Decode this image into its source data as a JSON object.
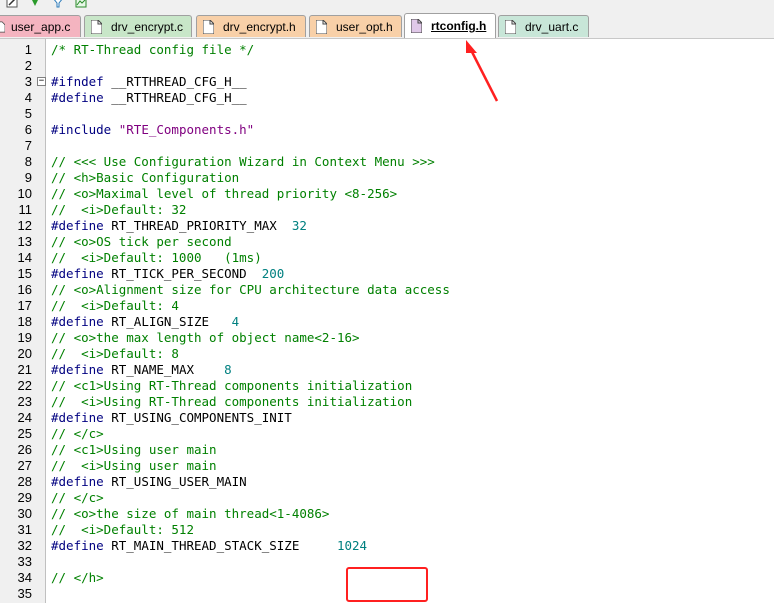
{
  "toolbar": {
    "icons": [
      "edit-icon",
      "download-icon",
      "filter-icon",
      "image-icon"
    ]
  },
  "tabs": [
    {
      "label": "user_app.c",
      "color": "#f4b4c0",
      "active": false
    },
    {
      "label": "drv_encrypt.c",
      "color": "#c8e6c8",
      "active": false
    },
    {
      "label": "drv_encrypt.h",
      "color": "#f8d0a8",
      "active": false
    },
    {
      "label": "user_opt.h",
      "color": "#f8d0a8",
      "active": false
    },
    {
      "label": "rtconfig.h",
      "color": "#e0c8e8",
      "active": true
    },
    {
      "label": "drv_uart.c",
      "color": "#c8e6d8",
      "active": false
    }
  ],
  "lines": [
    {
      "n": "1",
      "segs": [
        [
          "/* RT-Thread config file */",
          "comment"
        ]
      ]
    },
    {
      "n": "2",
      "segs": []
    },
    {
      "n": "3",
      "segs": [
        [
          "#ifndef",
          "pre"
        ],
        [
          " __RTTHREAD_CFG_H__",
          "plain"
        ]
      ],
      "fold": true
    },
    {
      "n": "4",
      "segs": [
        [
          "#define",
          "pre"
        ],
        [
          " __RTTHREAD_CFG_H__",
          "plain"
        ]
      ]
    },
    {
      "n": "5",
      "segs": []
    },
    {
      "n": "6",
      "segs": [
        [
          "#include",
          "pre"
        ],
        [
          " ",
          "plain"
        ],
        [
          "\"RTE_Components.h\"",
          "str"
        ]
      ]
    },
    {
      "n": "7",
      "segs": []
    },
    {
      "n": "8",
      "segs": [
        [
          "// <<< Use Configuration Wizard in Context Menu >>>",
          "comment"
        ]
      ]
    },
    {
      "n": "9",
      "segs": [
        [
          "// <h>Basic Configuration",
          "comment"
        ]
      ]
    },
    {
      "n": "10",
      "segs": [
        [
          "// <o>Maximal level of thread priority <8-256>",
          "comment"
        ]
      ]
    },
    {
      "n": "11",
      "segs": [
        [
          "//  <i>Default: 32",
          "comment"
        ]
      ]
    },
    {
      "n": "12",
      "segs": [
        [
          "#define",
          "pre"
        ],
        [
          " RT_THREAD_PRIORITY_MAX  ",
          "plain"
        ],
        [
          "32",
          "num"
        ]
      ]
    },
    {
      "n": "13",
      "segs": [
        [
          "// <o>OS tick per second",
          "comment"
        ]
      ]
    },
    {
      "n": "14",
      "segs": [
        [
          "//  <i>Default: 1000   (1ms)",
          "comment"
        ]
      ]
    },
    {
      "n": "15",
      "segs": [
        [
          "#define",
          "pre"
        ],
        [
          " RT_TICK_PER_SECOND  ",
          "plain"
        ],
        [
          "200",
          "num"
        ]
      ]
    },
    {
      "n": "16",
      "segs": [
        [
          "// <o>Alignment size for CPU architecture data access",
          "comment"
        ]
      ]
    },
    {
      "n": "17",
      "segs": [
        [
          "//  <i>Default: 4",
          "comment"
        ]
      ]
    },
    {
      "n": "18",
      "segs": [
        [
          "#define",
          "pre"
        ],
        [
          " RT_ALIGN_SIZE   ",
          "plain"
        ],
        [
          "4",
          "num"
        ]
      ]
    },
    {
      "n": "19",
      "segs": [
        [
          "// <o>the max length of object name<2-16>",
          "comment"
        ]
      ]
    },
    {
      "n": "20",
      "segs": [
        [
          "//  <i>Default: 8",
          "comment"
        ]
      ]
    },
    {
      "n": "21",
      "segs": [
        [
          "#define",
          "pre"
        ],
        [
          " RT_NAME_MAX    ",
          "plain"
        ],
        [
          "8",
          "num"
        ]
      ]
    },
    {
      "n": "22",
      "segs": [
        [
          "// <c1>Using RT-Thread components initialization",
          "comment"
        ]
      ]
    },
    {
      "n": "23",
      "segs": [
        [
          "//  <i>Using RT-Thread components initialization",
          "comment"
        ]
      ]
    },
    {
      "n": "24",
      "segs": [
        [
          "#define",
          "pre"
        ],
        [
          " RT_USING_COMPONENTS_INIT",
          "plain"
        ]
      ]
    },
    {
      "n": "25",
      "segs": [
        [
          "// </c>",
          "comment"
        ]
      ]
    },
    {
      "n": "26",
      "segs": [
        [
          "// <c1>Using user main",
          "comment"
        ]
      ]
    },
    {
      "n": "27",
      "segs": [
        [
          "//  <i>Using user main",
          "comment"
        ]
      ]
    },
    {
      "n": "28",
      "segs": [
        [
          "#define",
          "pre"
        ],
        [
          " RT_USING_USER_MAIN",
          "plain"
        ]
      ]
    },
    {
      "n": "29",
      "segs": [
        [
          "// </c>",
          "comment"
        ]
      ]
    },
    {
      "n": "30",
      "segs": [
        [
          "// <o>the size of main thread<1-4086>",
          "comment"
        ]
      ]
    },
    {
      "n": "31",
      "segs": [
        [
          "//  <i>Default: 512",
          "comment"
        ]
      ]
    },
    {
      "n": "32",
      "segs": [
        [
          "#define",
          "pre"
        ],
        [
          " RT_MAIN_THREAD_STACK_SIZE     ",
          "plain"
        ],
        [
          "1024",
          "num"
        ]
      ]
    },
    {
      "n": "33",
      "segs": []
    },
    {
      "n": "34",
      "segs": [
        [
          "// </h>",
          "comment"
        ]
      ]
    },
    {
      "n": "35",
      "segs": []
    }
  ],
  "colors": {
    "comment": "#008000",
    "pre": "#000080",
    "num": "#008080",
    "str": "#800080",
    "annotation": "#ff2020"
  }
}
